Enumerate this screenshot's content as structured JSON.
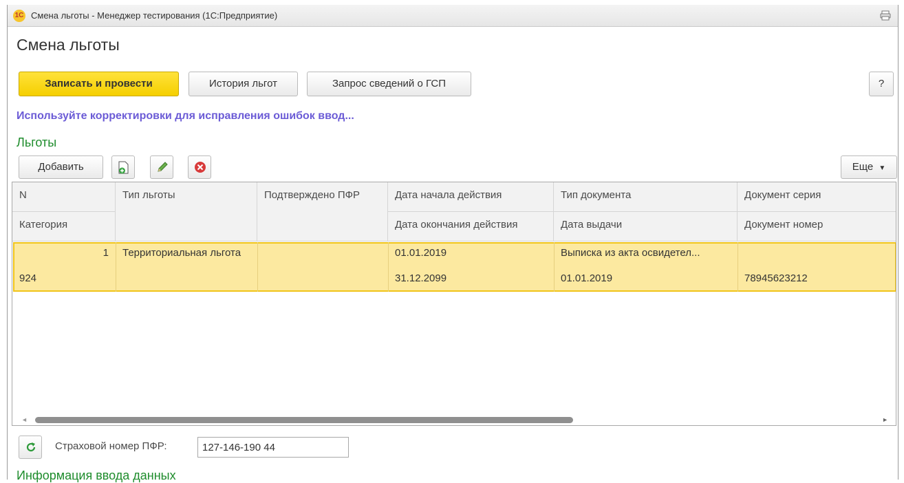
{
  "window": {
    "title": "Смена льготы - Менеджер тестирования (1С:Предприятие)",
    "logo_text": "1С"
  },
  "page": {
    "title": "Смена льготы"
  },
  "toolbar": {
    "save_post_label": "Записать и провести",
    "history_label": "История льгот",
    "gsp_request_label": "Запрос сведений о ГСП",
    "help_label": "?"
  },
  "hint": {
    "text": "Используйте корректировки для исправления ошибок ввод..."
  },
  "benefits": {
    "section_title": "Льготы",
    "add_label": "Добавить",
    "more_label": "Еще",
    "columns_row1": [
      "N",
      "Тип льготы",
      "Подтверждено ПФР",
      "Дата начала действия",
      "Тип документа",
      "Документ серия"
    ],
    "columns_row2": [
      "Категория",
      "",
      "",
      "Дата окончания действия",
      "Дата выдачи",
      "Документ номер"
    ],
    "rows": [
      {
        "n": "1",
        "category": "924",
        "benefit_type": "Территориальная льгота",
        "pfr_confirmed": "",
        "start_date": "01.01.2019",
        "end_date": "31.12.2099",
        "doc_type": "Выписка из акта освидетел...",
        "issue_date": "01.01.2019",
        "doc_series": "",
        "doc_number": "78945623212"
      }
    ]
  },
  "pfr": {
    "label": "Страховой номер ПФР:",
    "value": "127-146-190 44"
  },
  "bottom_section": {
    "title": "Информация ввода данных"
  },
  "colors": {
    "primary_button": "#f5cf00",
    "section_green": "#1e8c2c",
    "hint_purple": "#6b5bd6",
    "selected_row": "#fce9a0"
  }
}
